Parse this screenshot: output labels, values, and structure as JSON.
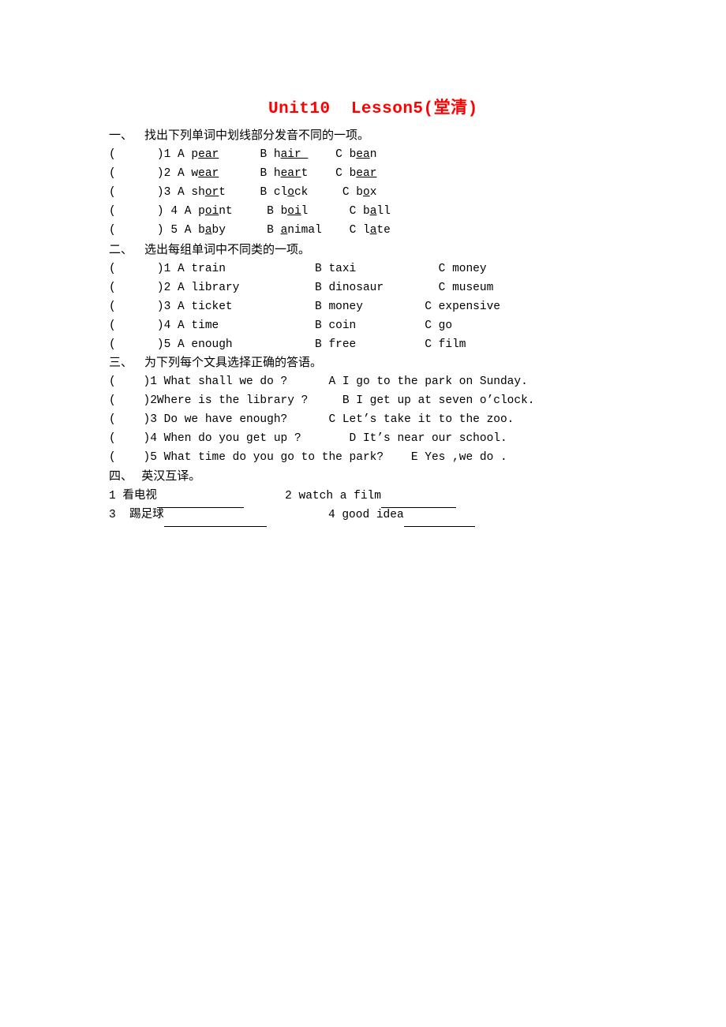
{
  "document": {
    "title": "Unit10  Lesson5(堂清)",
    "title_color": "#ff0000",
    "body_color": "#000000",
    "background": "#ffffff"
  },
  "sections": [
    {
      "id": "section-1",
      "heading": "一、    找出下列单词中划线部分发音不同的一项。",
      "rows": [
        {
          "prefix": "(      )1 A ",
          "parts": [
            {
              "pre": "p",
              "underlined": "ear",
              "post": ""
            },
            {
              "gap": "      B ",
              "pre": "h",
              "underlined": "air ",
              "post": ""
            },
            {
              "gap": "    C ",
              "pre": "b",
              "underlined": "ea",
              "post": "n"
            }
          ]
        },
        {
          "prefix": "(      )2 A ",
          "parts": [
            {
              "pre": "w",
              "underlined": "ear",
              "post": ""
            },
            {
              "gap": "      B ",
              "pre": "h",
              "underlined": "ear",
              "post": "t"
            },
            {
              "gap": "    C ",
              "pre": "b",
              "underlined": "ear",
              "post": ""
            }
          ]
        },
        {
          "prefix": "(      )3 A ",
          "parts": [
            {
              "pre": "sh",
              "underlined": "or",
              "post": "t"
            },
            {
              "gap": "     B ",
              "pre": "cl",
              "underlined": "o",
              "post": "ck"
            },
            {
              "gap": "     C ",
              "pre": "b",
              "underlined": "o",
              "post": "x"
            }
          ]
        },
        {
          "prefix": "(      ) 4 A ",
          "parts": [
            {
              "pre": "p",
              "underlined": "oi",
              "post": "nt"
            },
            {
              "gap": "     B ",
              "pre": "b",
              "underlined": "oi",
              "post": "l"
            },
            {
              "gap": "      C ",
              "pre": "b",
              "underlined": "a",
              "post": "ll"
            }
          ]
        },
        {
          "prefix": "(      ) 5 A ",
          "parts": [
            {
              "pre": "b",
              "underlined": "a",
              "post": "by"
            },
            {
              "gap": "      B ",
              "pre": "",
              "underlined": "a",
              "post": "nimal"
            },
            {
              "gap": "    C ",
              "pre": "l",
              "underlined": "a",
              "post": "te"
            }
          ]
        }
      ]
    },
    {
      "id": "section-2",
      "heading": "二、    选出每组单词中不同类的一项。",
      "rows": [
        {
          "text": "(      )1 A train             B taxi            C money"
        },
        {
          "text": "(      )2 A library           B dinosaur        C museum"
        },
        {
          "text": "(      )3 A ticket            B money         C expensive"
        },
        {
          "text": "(      )4 A time              B coin          C go"
        },
        {
          "text": "(      )5 A enough            B free          C film"
        }
      ]
    },
    {
      "id": "section-3",
      "heading": "三、    为下列每个文具选择正确的答语。",
      "rows": [
        {
          "text": "(    )1 What shall we do ?      A I go to the park on Sunday."
        },
        {
          "text": "(    )2Where is the library ?     B I get up at seven o’clock."
        },
        {
          "text": "(    )3 Do we have enough?      C Let’s take it to the zoo."
        },
        {
          "text": "(    )4 When do you get up ?       D It’s near our school."
        },
        {
          "text": "(    )5 What time do you go to the park?    E Yes ,we do ."
        }
      ]
    },
    {
      "id": "section-4",
      "heading": "四、   英汉互译。",
      "translation_items": [
        {
          "number": "1",
          "term": "看电视",
          "is_cjk": true,
          "blank_width": 110
        },
        {
          "number": "2",
          "term": "watch a film",
          "is_cjk": false,
          "blank_width": 95
        },
        {
          "number": "3",
          "term": "踢足球",
          "is_cjk": true,
          "blank_width": 130
        },
        {
          "number": "4",
          "term": "good idea",
          "is_cjk": false,
          "blank_width": 90
        }
      ]
    }
  ]
}
